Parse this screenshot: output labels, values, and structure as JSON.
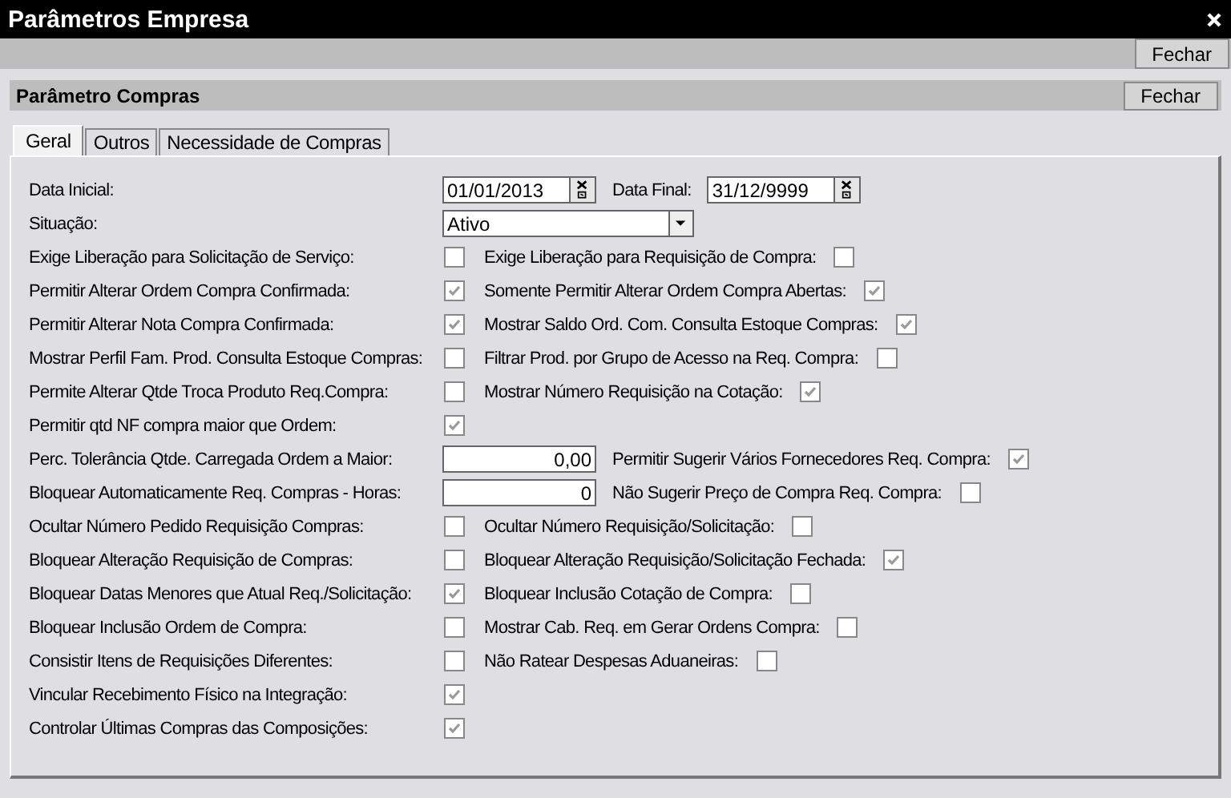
{
  "window": {
    "title": "Parâmetros Empresa"
  },
  "toolbar": {
    "close_button": "Fechar"
  },
  "panel": {
    "title": "Parâmetro Compras",
    "close_button": "Fechar"
  },
  "tabs": [
    {
      "label": "Geral",
      "selected": true
    },
    {
      "label": "Outros",
      "selected": false
    },
    {
      "label": "Necessidade de Compras",
      "selected": false
    }
  ],
  "rows": [
    {
      "left": {
        "kind": "date",
        "label": "Data Inicial:",
        "value": "01/01/2013"
      },
      "right": {
        "kind": "date",
        "label": "Data Final:",
        "value": "31/12/9999"
      }
    },
    {
      "left": {
        "kind": "select",
        "label": "Situação:",
        "value": "Ativo"
      }
    },
    {
      "left": {
        "kind": "check",
        "label": "Exige Liberação para Solicitação de Serviço:",
        "checked": false
      },
      "right": {
        "kind": "check",
        "label": "Exige Liberação para Requisição de Compra:",
        "checked": false
      }
    },
    {
      "left": {
        "kind": "check",
        "label": "Permitir Alterar Ordem Compra Confirmada:",
        "checked": true
      },
      "right": {
        "kind": "check",
        "label": "Somente Permitir Alterar Ordem Compra Abertas:",
        "checked": true
      }
    },
    {
      "left": {
        "kind": "check",
        "label": "Permitir Alterar Nota Compra Confirmada:",
        "checked": true
      },
      "right": {
        "kind": "check",
        "label": "Mostrar Saldo Ord. Com. Consulta Estoque Compras:",
        "checked": true
      }
    },
    {
      "left": {
        "kind": "check",
        "label": "Mostrar Perfil Fam. Prod. Consulta Estoque Compras:",
        "checked": false
      },
      "right": {
        "kind": "check",
        "label": "Filtrar Prod. por Grupo de Acesso na Req. Compra:",
        "checked": false
      }
    },
    {
      "left": {
        "kind": "check",
        "label": "Permite Alterar Qtde Troca Produto Req.Compra:",
        "checked": false
      },
      "right": {
        "kind": "check",
        "label": "Mostrar Número Requisição na Cotação:",
        "checked": true
      }
    },
    {
      "left": {
        "kind": "check",
        "label": "Permitir qtd NF compra maior que Ordem:",
        "checked": true
      }
    },
    {
      "left": {
        "kind": "number",
        "label": "Perc. Tolerância Qtde. Carregada Ordem a Maior:",
        "value": "0,00"
      },
      "right": {
        "kind": "check",
        "label": "Permitir Sugerir Vários Fornecedores Req. Compra:",
        "checked": true
      }
    },
    {
      "left": {
        "kind": "number",
        "label": "Bloquear Automaticamente Req. Compras - Horas:",
        "value": "0"
      },
      "right": {
        "kind": "check",
        "label": "Não Sugerir Preço de Compra Req. Compra:",
        "checked": false
      }
    },
    {
      "left": {
        "kind": "check",
        "label": "Ocultar Número Pedido Requisição Compras:",
        "checked": false
      },
      "right": {
        "kind": "check",
        "label": "Ocultar Número Requisição/Solicitação:",
        "checked": false
      }
    },
    {
      "left": {
        "kind": "check",
        "label": "Bloquear Alteração Requisição de Compras:",
        "checked": false
      },
      "right": {
        "kind": "check",
        "label": "Bloquear Alteração Requisição/Solicitação Fechada:",
        "checked": true
      }
    },
    {
      "left": {
        "kind": "check",
        "label": "Bloquear Datas Menores que Atual Req./Solicitação:",
        "checked": true
      },
      "right": {
        "kind": "check",
        "label": "Bloquear Inclusão Cotação de Compra:",
        "checked": false
      }
    },
    {
      "left": {
        "kind": "check",
        "label": "Bloquear Inclusão Ordem de Compra:",
        "checked": false
      },
      "right": {
        "kind": "check",
        "label": "Mostrar Cab. Req. em Gerar Ordens Compra:",
        "checked": false
      }
    },
    {
      "left": {
        "kind": "check",
        "label": "Consistir Itens de Requisições Diferentes:",
        "checked": false
      },
      "right": {
        "kind": "check",
        "label": "Não Ratear Despesas Aduaneiras:",
        "checked": false
      }
    },
    {
      "left": {
        "kind": "check",
        "label": "Vincular Recebimento Físico na Integração:",
        "checked": true
      }
    },
    {
      "left": {
        "kind": "check",
        "label": "Controlar Últimas Compras das Composições:",
        "checked": true
      }
    }
  ]
}
